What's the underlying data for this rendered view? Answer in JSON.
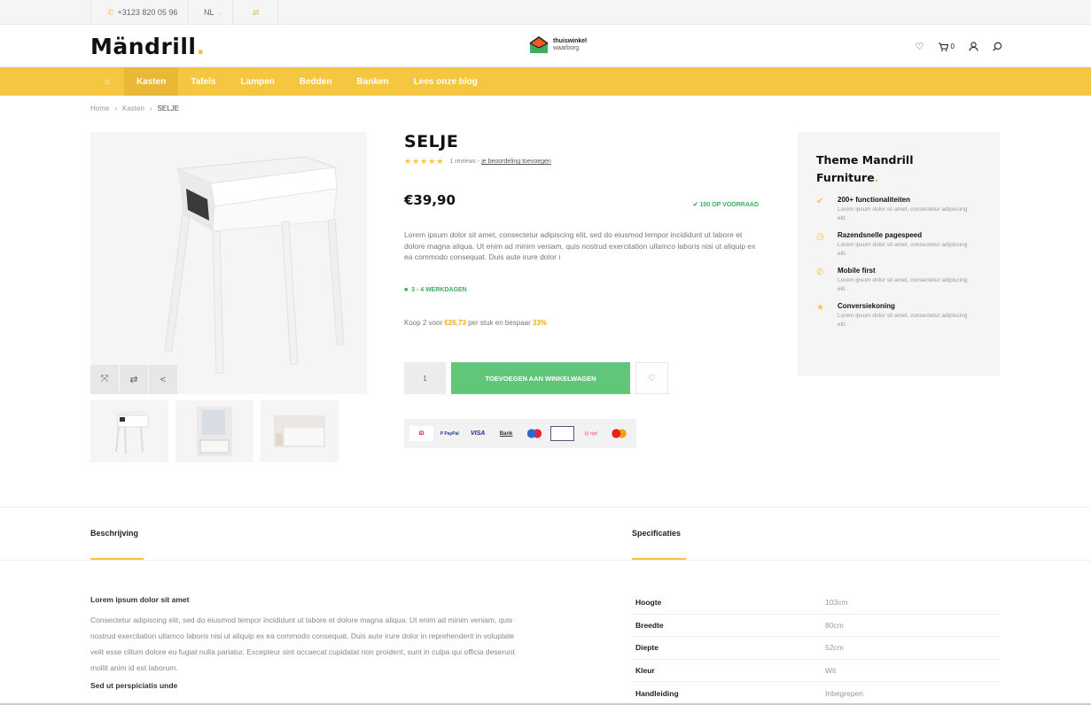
{
  "topbar": {
    "phone": "+3123 820 05 96",
    "lang": "NL"
  },
  "brand": {
    "name": "Mändrill",
    "dot": "."
  },
  "trust": {
    "line1": "thuiswinkel",
    "line2": "waarborg"
  },
  "header": {
    "cart_count": "0"
  },
  "nav": {
    "items": [
      "Kasten",
      "Tafels",
      "Lampen",
      "Bedden",
      "Banken",
      "Lees onze blog"
    ]
  },
  "breadcrumb": [
    "Home",
    "›",
    "Kasten",
    "›",
    "SELJE"
  ],
  "product": {
    "title": "SELJE",
    "reviews": "1 reviews -",
    "review_link": "je beoordeling toevoegen",
    "price": "€39,90",
    "stock": "100 OP VOORRAAD",
    "description": "Lorem ipsum dolor sit amet, consectetur adipiscing elit, sed do eiusmod tempor incididunt ut labore et dolore magna aliqua. Ut enim ad minim veniam, quis nostrud exercitation ullamco laboris nisi ut aliquip ex ea commodo consequat. Duis aute irure dolor i",
    "delivery": "3 - 4 WERKDAGEN",
    "bulk_pre": "Koop 2 voor",
    "bulk_price": "€26,73",
    "bulk_mid": "per stuk en bespaar",
    "bulk_pct": "33%",
    "qty": "1",
    "cart_label": "TOEVOEGEN AAN WINKELWAGEN",
    "payments": [
      "iD",
      "P PayPal",
      "VISA",
      "Bank",
      "",
      "",
      "@ rtpt",
      ""
    ]
  },
  "sidebar": {
    "title_line1": "Theme Mandrill",
    "title_line2": "Furniture",
    "features": [
      {
        "title": "200+ functionaliteiten",
        "desc": "Lorem ipsum dolor sit amet, consectetur adipiscing elit."
      },
      {
        "title": "Razendsnelle pagespeed",
        "desc": "Lorem ipsum dolor sit amet, consectetur adipiscing elit."
      },
      {
        "title": "Mobile first",
        "desc": "Lorem ipsum dolor sit amet, consectetur adipiscing elit."
      },
      {
        "title": "Conversiekoning",
        "desc": "Lorem ipsum dolor sit amet, consectetur adipiscing elit."
      }
    ]
  },
  "tabs": {
    "description": "Beschrijving",
    "specs": "Specificaties"
  },
  "content": {
    "heading": "Lorem ipsum dolor sit amet",
    "body": "Consectetur adipiscing elit, sed do eiusmod tempor incididunt ut labore et dolore magna aliqua. Ut enim ad minim veniam, quis nostrud exercitation ullamco laboris nisi ut aliquip ex ea commodo consequat. Duis aute irure dolor in reprehenderit in voluptate velit esse cillum dolore eu fugiat nulla pariatur. Excepteur sint occaecat cupidatat non proident, sunt in culpa qui officia deserunt mollit anim id est laborum.",
    "subheading": "Sed ut perspiciatis unde"
  },
  "specs": [
    {
      "k": "Hoogte",
      "v": "103cm"
    },
    {
      "k": "Breedte",
      "v": "80cm"
    },
    {
      "k": "Diepte",
      "v": "52cm"
    },
    {
      "k": "Kleur",
      "v": "Wit"
    },
    {
      "k": "Handleiding",
      "v": "Inbegrepen"
    }
  ],
  "colors": {
    "accent": "#f5c63f",
    "green": "#5fc67a"
  }
}
